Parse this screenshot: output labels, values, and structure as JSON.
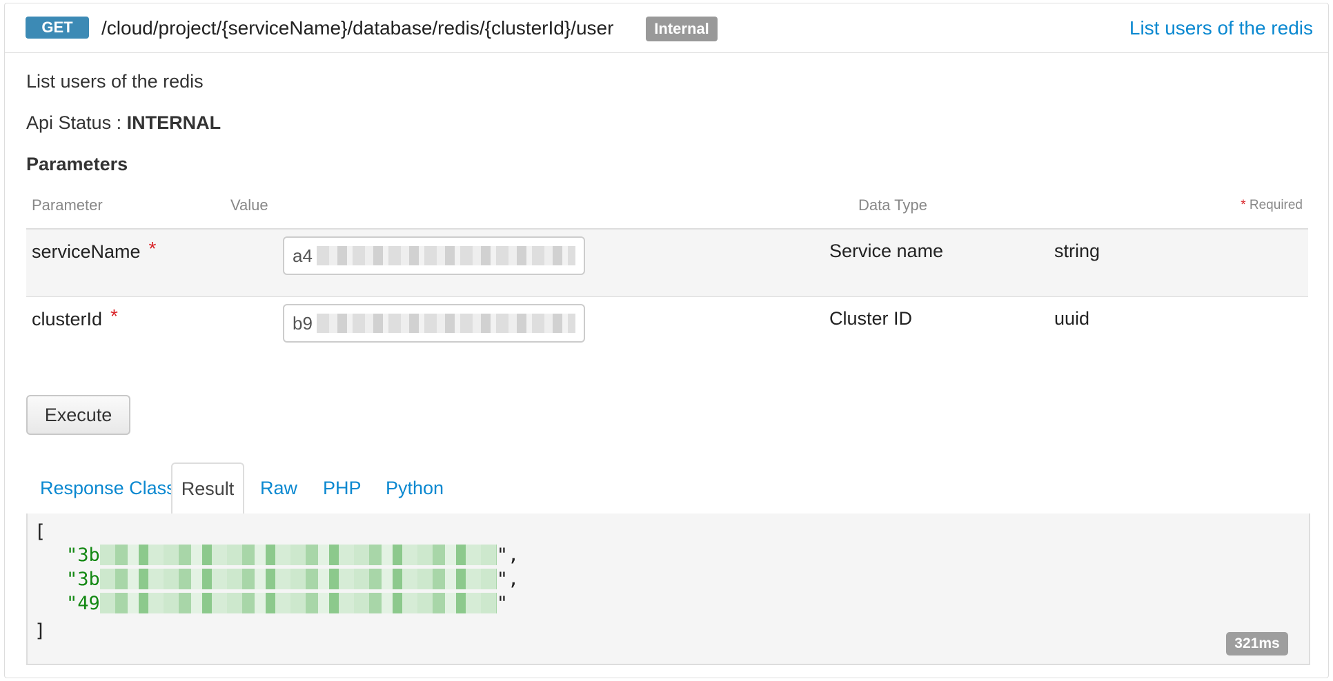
{
  "header": {
    "method": "GET",
    "path": "/cloud/project/{serviceName}/database/redis/{clusterId}/user",
    "status_badge": "Internal",
    "summary_link": "List users of the redis"
  },
  "description": "List users of the redis",
  "api_status": {
    "label": "Api Status :",
    "value": "INTERNAL"
  },
  "parameters": {
    "heading": "Parameters",
    "columns": {
      "parameter": "Parameter",
      "value": "Value",
      "data_type": "Data Type",
      "required_star": "*",
      "required_label": "Required"
    },
    "rows": [
      {
        "name": "serviceName",
        "required": "*",
        "value_visible": "a4",
        "description": "Service name",
        "type": "string"
      },
      {
        "name": "clusterId",
        "required": "*",
        "value_visible": "b9",
        "description": "Cluster ID",
        "type": "uuid"
      }
    ]
  },
  "execute_label": "Execute",
  "tabs": [
    {
      "label": "Response Class",
      "active": false
    },
    {
      "label": "Result",
      "active": true
    },
    {
      "label": "Raw",
      "active": false
    },
    {
      "label": "PHP",
      "active": false
    },
    {
      "label": "Python",
      "active": false
    }
  ],
  "result": {
    "open": "[",
    "items": [
      {
        "prefix": "\"3b",
        "suffix": "\","
      },
      {
        "prefix": "\"3b",
        "suffix": "\","
      },
      {
        "prefix": "\"49",
        "suffix": "\""
      }
    ],
    "close": "]",
    "timing": "321ms"
  },
  "colors": {
    "method_badge": "#3c8ab5",
    "link": "#0a88d0",
    "status_badge": "#999999",
    "required_star": "#d9262b",
    "json_string": "#138813"
  }
}
